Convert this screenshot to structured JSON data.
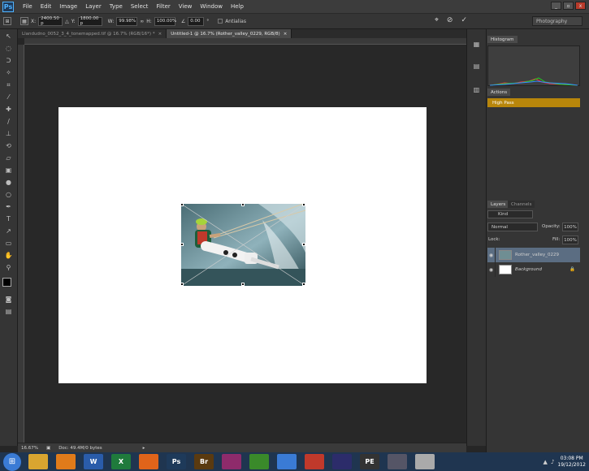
{
  "app": {
    "logo_text": "Ps"
  },
  "menu": [
    "File",
    "Edit",
    "Image",
    "Layer",
    "Type",
    "Select",
    "Filter",
    "View",
    "Window",
    "Help"
  ],
  "window_controls": {
    "minimize": "_",
    "restore": "▫",
    "close": "x"
  },
  "options": {
    "x_label": "X:",
    "x_value": "2400.50 p",
    "y_label": "Y:",
    "y_value": "1800.00 p",
    "w_label": "W:",
    "w_value": "99.98%",
    "h_label": "H:",
    "h_value": "100.00%",
    "angle_value": "0.00",
    "angle_unit": "°",
    "antialias_label": "Antialias",
    "workspace": "Photography"
  },
  "doc_tabs": [
    {
      "label": "Llandudno_0052_3_4_tonemapped.tif @ 16.7% (RGB/16*) *",
      "close": "×"
    },
    {
      "label": "Untitled-1 @ 16.7% (Rother_valley_0229, RGB/8)",
      "close": "×"
    }
  ],
  "status": {
    "zoom": "16.67%",
    "doc_info": "Doc: 49.4M/0 bytes"
  },
  "panels": {
    "histogram_tab": "Histogram",
    "actions_tab": "Actions",
    "action_item": "High Pass",
    "layers_tab": "Layers",
    "channels_tab": "Channels",
    "kind_label": "Kind",
    "blend_mode": "Normal",
    "opacity_label": "Opacity:",
    "opacity_value": "100%",
    "lock_label": "Lock:",
    "fill_label": "Fill:",
    "fill_value": "100%",
    "layers": [
      {
        "name": "Rother_valley_0229"
      },
      {
        "name": "Background"
      }
    ]
  },
  "taskbar": {
    "apps": [
      {
        "icon": "folder-icon",
        "label": "",
        "color": "#d9a530"
      },
      {
        "icon": "media-player-icon",
        "label": "",
        "color": "#e07b1a"
      },
      {
        "icon": "word-icon",
        "label": "W",
        "color": "#2a5caa"
      },
      {
        "icon": "excel-icon",
        "label": "X",
        "color": "#1f7a3c"
      },
      {
        "icon": "firefox-icon",
        "label": "",
        "color": "#e0641a"
      },
      {
        "icon": "photoshop-icon",
        "label": "Ps",
        "color": "#1e3a5a"
      },
      {
        "icon": "bridge-icon",
        "label": "Br",
        "color": "#5a3a10"
      },
      {
        "icon": "app-icon",
        "label": "",
        "color": "#8e2b6b"
      },
      {
        "icon": "app-icon",
        "label": "",
        "color": "#3a8a2a"
      },
      {
        "icon": "app-icon",
        "label": "",
        "color": "#3a7bd5"
      },
      {
        "icon": "app-icon",
        "label": "",
        "color": "#c0392b"
      },
      {
        "icon": "app-icon",
        "label": "",
        "color": "#2c2c6a"
      },
      {
        "icon": "app-icon",
        "label": "PE",
        "color": "#333"
      },
      {
        "icon": "app-icon",
        "label": "",
        "color": "#556"
      },
      {
        "icon": "app-icon",
        "label": "",
        "color": "#aaa"
      }
    ],
    "time": "03:08 PM",
    "date": "19/12/2012"
  }
}
